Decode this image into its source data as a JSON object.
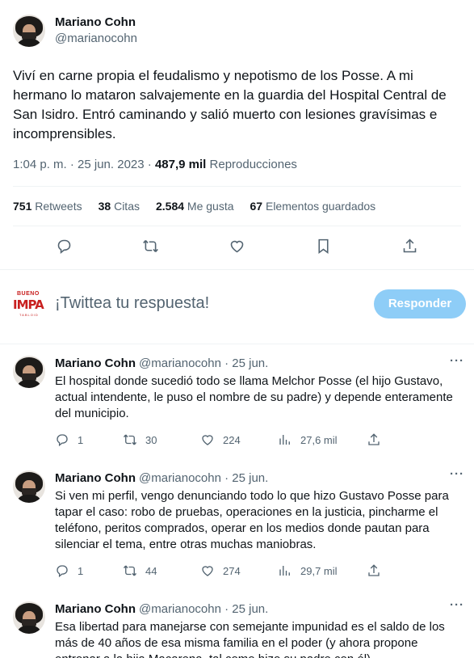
{
  "main": {
    "author_name": "Mariano Cohn",
    "author_handle": "@marianocohn",
    "text": "Viví en carne propia el feudalismo y nepotismo de los Posse. A mi hermano lo mataron salvajemente en la guardia del Hospital Central de San Isidro. Entró caminando y salió muerto con lesiones gravísimas e incomprensibles.",
    "timestamp": "1:04 p. m. · 25 jun. 2023 ·",
    "views_count": "487,9 mil",
    "views_label": "Reproducciones",
    "stats": [
      {
        "count": "751",
        "label": "Retweets"
      },
      {
        "count": "38",
        "label": "Citas"
      },
      {
        "count": "2.584",
        "label": "Me gusta"
      },
      {
        "count": "67",
        "label": "Elementos guardados"
      }
    ],
    "actions": [
      "reply-icon",
      "retweet-icon",
      "like-icon",
      "bookmark-icon",
      "share-icon"
    ]
  },
  "composer": {
    "logo_top": "BUENO",
    "logo_mid": "IMPA",
    "logo_bottom": "TABLOID",
    "placeholder": "¡Twittea tu respuesta!",
    "button_label": "Responder",
    "button_color": "#8ecdf7"
  },
  "replies": [
    {
      "name": "Mariano Cohn",
      "meta": "@marianocohn · 25 jun.",
      "text": "El hospital donde sucedió todo se llama Melchor Posse (el hijo Gustavo, actual intendente, le puso el nombre de su padre) y depende enteramente del municipio.",
      "replies": "1",
      "retweets": "30",
      "likes": "224",
      "views": "27,6 mil"
    },
    {
      "name": "Mariano Cohn",
      "meta": "@marianocohn · 25 jun.",
      "text": "Si ven mi perfil, vengo denunciando todo lo que hizo Gustavo Posse para tapar el caso: robo de pruebas, operaciones en la justicia, pincharme el teléfono, peritos comprados, operar en los medios donde pautan para silenciar el tema, entre otras muchas maniobras.",
      "replies": "1",
      "retweets": "44",
      "likes": "274",
      "views": "29,7 mil"
    },
    {
      "name": "Mariano Cohn",
      "meta": "@marianocohn · 25 jun.",
      "text": "Esa libertad para manejarse con semejante impunidad es el saldo de los más de 40 años de esa misma familia en el poder (y ahora propone entronar a la hija Macarena, tal como hizo su padre con él).",
      "replies": "",
      "retweets": "",
      "likes": "",
      "views": ""
    }
  ],
  "more_label": "···",
  "colors": {
    "text": "#0f1419",
    "secondary": "#536471",
    "divider": "#eff3f4",
    "brand_red": "#c8201f"
  }
}
